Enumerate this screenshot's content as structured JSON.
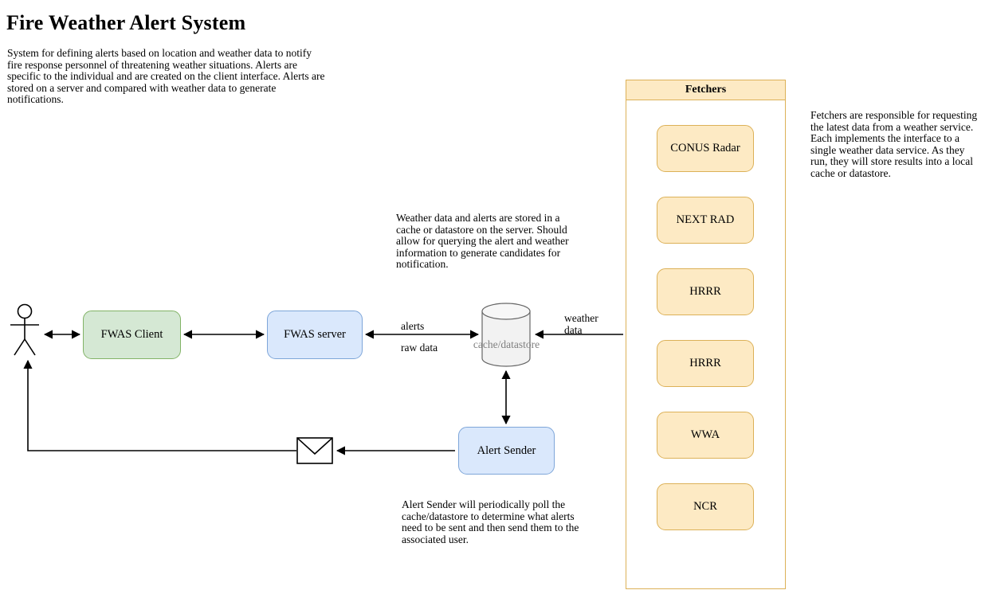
{
  "page": {
    "title": "Fire Weather Alert System",
    "description": "System for defining alerts based on location and weather data to notify fire response personnel of threatening weather situations. Alerts are specific to the individual and are created on the client interface. Alerts are stored on a server and compared with weather data to generate notifications."
  },
  "annotations": {
    "fetchers": "Fetchers are responsible for requesting the latest data from a weather service. Each implements the interface to a single weather data service. As they run, they will store results into a local cache or datastore.",
    "datastore": "Weather data and alerts are stored in a cache or datastore on the server. Should allow for querying the alert and weather information to generate candidates for notification.",
    "alert_sender": "Alert Sender will periodically poll the cache/datastore to determine what alerts need to be sent and then send them to the associated user."
  },
  "nodes": {
    "actor": "user-actor",
    "fwas_client": "FWAS Client",
    "fwas_server": "FWAS server",
    "cache_datastore": "cache/datastore",
    "alert_sender": "Alert Sender",
    "envelope": "notification-envelope"
  },
  "edges": {
    "alerts": "alerts",
    "raw_data": "raw data",
    "weather_data": "weather data"
  },
  "fetchers_panel": {
    "header": "Fetchers",
    "items": [
      {
        "label": "CONUS Radar"
      },
      {
        "label": "NEXT RAD"
      },
      {
        "label": "HRRR"
      },
      {
        "label": "HRRR"
      },
      {
        "label": "WWA"
      },
      {
        "label": "NCR"
      }
    ]
  },
  "colors": {
    "green_fill": "#d5e8d4",
    "green_border": "#82b366",
    "blue_fill": "#dae8fc",
    "blue_border": "#7ea6d9",
    "orange_fill": "#fdeac4",
    "orange_border": "#dcb158",
    "cylinder_fill": "#f2f2f2",
    "cylinder_border": "#666666",
    "stroke": "#000000"
  }
}
